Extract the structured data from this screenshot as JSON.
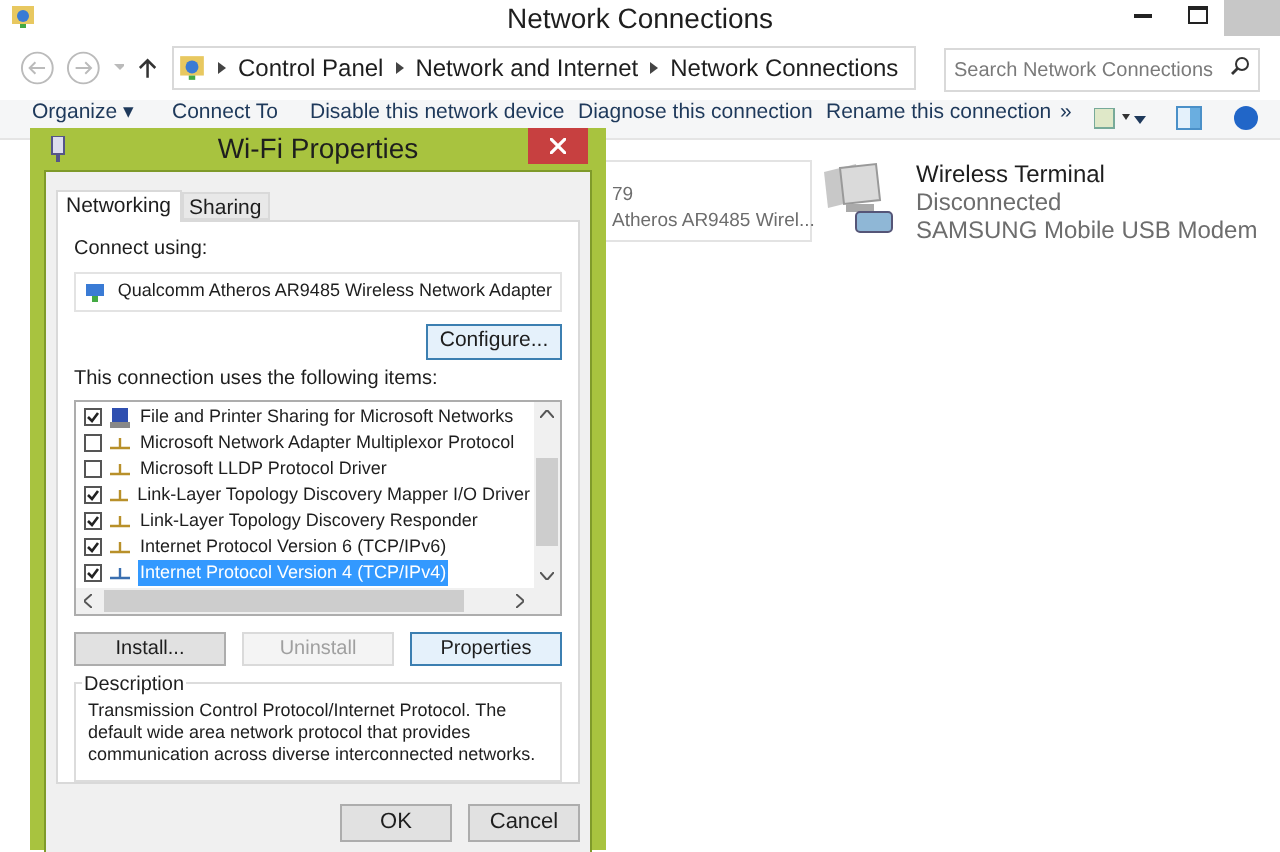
{
  "window": {
    "title": "Network Connections"
  },
  "address_bar": {
    "crumbs": [
      "Control Panel",
      "Network and Internet",
      "Network Connections"
    ]
  },
  "search": {
    "placeholder": "Search Network Connections"
  },
  "toolbar": {
    "items": [
      "Organize ▾",
      "Connect To",
      "Disable this network device",
      "Diagnose this connection",
      "Rename this connection",
      "»"
    ]
  },
  "connections": [
    {
      "line_1": "79",
      "line_2": "Atheros AR9485 Wirel..."
    },
    {
      "name": "Wireless Terminal",
      "status": "Disconnected",
      "device": "SAMSUNG Mobile USB Modem"
    }
  ],
  "dialog": {
    "title": "Wi-Fi Properties",
    "tabs": [
      {
        "label": "Networking",
        "selected": true
      },
      {
        "label": "Sharing",
        "selected": false
      }
    ],
    "connect_using_label": "Connect using:",
    "adapter": "Qualcomm Atheros AR9485 Wireless Network Adapter",
    "configure_button": "Configure...",
    "items_label": "This connection uses the following items:",
    "items": [
      {
        "label": "File and Printer Sharing for Microsoft Networks",
        "checked": true,
        "selected": false,
        "kind": "service"
      },
      {
        "label": "Microsoft Network Adapter Multiplexor Protocol",
        "checked": false,
        "selected": false,
        "kind": "protocol"
      },
      {
        "label": "Microsoft LLDP Protocol Driver",
        "checked": false,
        "selected": false,
        "kind": "protocol"
      },
      {
        "label": "Link-Layer Topology Discovery Mapper I/O Driver",
        "checked": true,
        "selected": false,
        "kind": "protocol"
      },
      {
        "label": "Link-Layer Topology Discovery Responder",
        "checked": true,
        "selected": false,
        "kind": "protocol"
      },
      {
        "label": "Internet Protocol Version 6 (TCP/IPv6)",
        "checked": true,
        "selected": false,
        "kind": "protocol"
      },
      {
        "label": "Internet Protocol Version 4 (TCP/IPv4)",
        "checked": true,
        "selected": true,
        "kind": "protocol"
      }
    ],
    "buttons": [
      {
        "label": "Install...",
        "disabled": false,
        "focused": false
      },
      {
        "label": "Uninstall",
        "disabled": true,
        "focused": false
      },
      {
        "label": "Properties",
        "disabled": false,
        "focused": true
      }
    ],
    "description_label": "Description",
    "description": "Transmission Control Protocol/Internet Protocol. The default wide area network protocol that provides communication across diverse interconnected networks.",
    "footer_buttons": [
      "OK",
      "Cancel"
    ]
  }
}
